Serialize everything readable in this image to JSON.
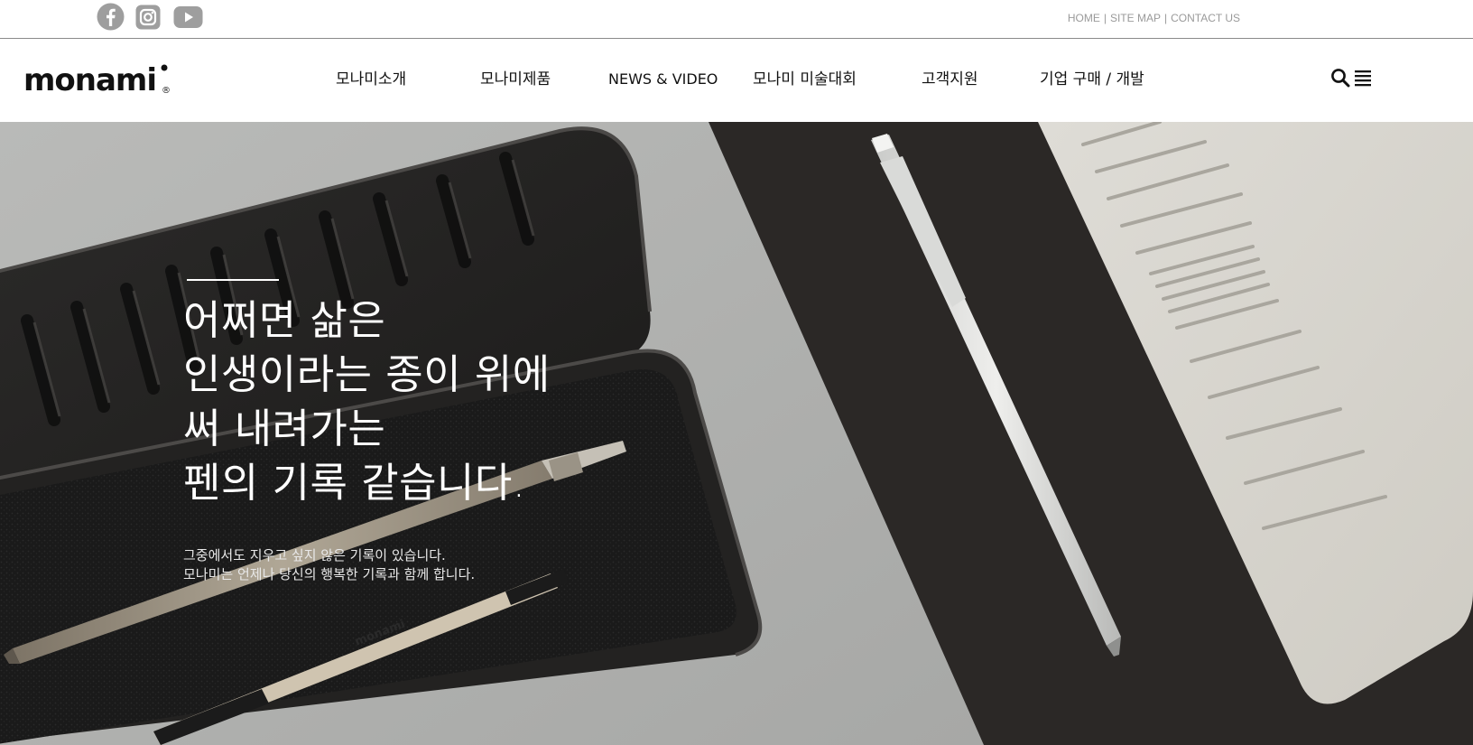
{
  "top_bar": {
    "social": [
      {
        "name": "facebook-icon"
      },
      {
        "name": "instagram-icon"
      },
      {
        "name": "youtube-icon"
      }
    ],
    "links": [
      "HOME",
      "SITE MAP",
      "CONTACT US"
    ],
    "separator": "|"
  },
  "header": {
    "logo_text": "monami",
    "logo_mark": "®",
    "nav": [
      "모나미소개",
      "모나미제품",
      "NEWS & VIDEO",
      "모나미 미술대회",
      "고객지원",
      "기업 구매 / 개발"
    ],
    "icons": [
      "search-icon",
      "menu-icon"
    ]
  },
  "hero": {
    "title_lines": [
      "어쩌면 삶은",
      "인생이라는 종이 위에",
      "써 내려가는",
      "펜의 기록 같습니다."
    ],
    "subtitle_lines": [
      "그중에서도 지우고 싶지 않은 기록이 있습니다.",
      "모나미는 언제나 당신의 행복한 기록과 함께 합니다."
    ],
    "pen_imprint": "monami"
  },
  "colors": {
    "text": "#111111",
    "utility_link": "#9a9a9a",
    "social_icon": "#9e9e9e",
    "hero_text": "#ffffff",
    "hero_dark": "#2a2826"
  }
}
